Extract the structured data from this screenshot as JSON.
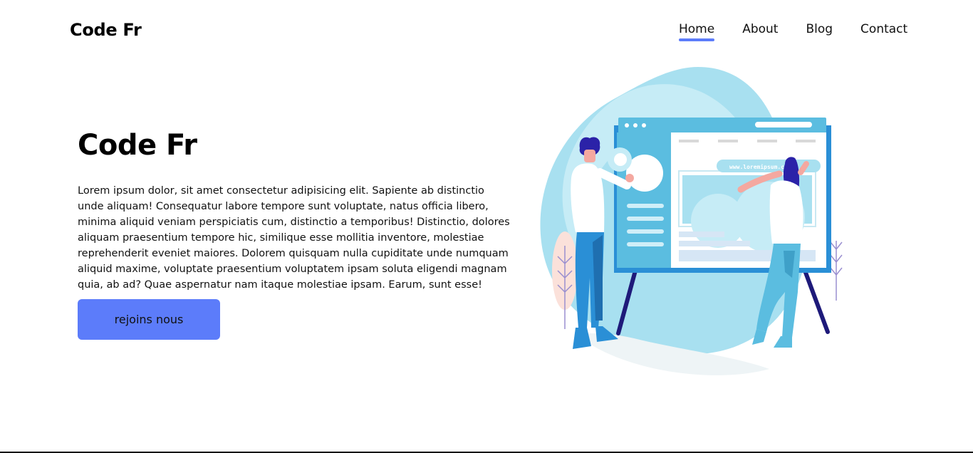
{
  "header": {
    "logo": "Code Fr",
    "nav": [
      {
        "label": "Home",
        "active": true
      },
      {
        "label": "About",
        "active": false
      },
      {
        "label": "Blog",
        "active": false
      },
      {
        "label": "Contact",
        "active": false
      }
    ]
  },
  "hero": {
    "title": "Code Fr",
    "text": "Lorem ipsum dolor, sit amet consectetur adipisicing elit. Sapiente ab distinctio unde aliquam! Consequatur labore tempore sunt voluptate, natus officia libero, minima aliquid veniam perspiciatis cum, distinctio a temporibus! Distinctio, dolores aliquam praesentium tempore hic, similique esse mollitia inventore, molestiae reprehenderit eveniet maiores. Dolorem quisquam nulla cupiditate unde numquam aliquid maxime, voluptate praesentium voluptatem ipsam soluta eligendi magnam quia, ab ad? Quae aspernatur nam itaque molestiae ipsam. Earum, sunt esse!",
    "button_label": "rejoins nous"
  },
  "illustration": {
    "url_text": "www.loremipsum.com"
  },
  "colors": {
    "accent": "#5c7cfa",
    "blob": "#a8e0f0"
  }
}
